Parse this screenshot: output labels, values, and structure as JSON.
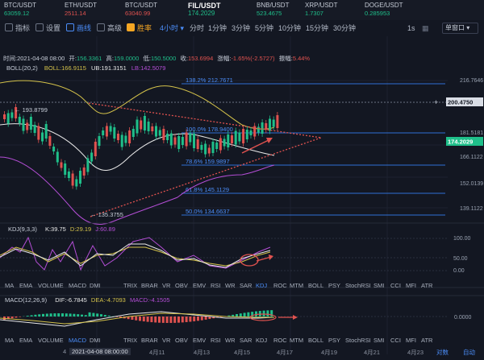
{
  "tickers": [
    {
      "sym": "BTC/USDT",
      "price": "63059.12",
      "dir": "up",
      "active": false
    },
    {
      "sym": "ETH/USDT",
      "price": "2511.14",
      "dir": "dn",
      "active": false
    },
    {
      "sym": "BTC/USDT",
      "price": "63040.99",
      "dir": "dn",
      "active": false
    },
    {
      "sym": "FIL/USDT",
      "price": "174.2029",
      "dir": "up",
      "active": true
    },
    {
      "sym": "BNB/USDT",
      "price": "523.4675",
      "dir": "up",
      "active": false
    },
    {
      "sym": "XRP/USDT",
      "price": "1.7307",
      "dir": "up",
      "active": false
    },
    {
      "sym": "DOGE/USDT",
      "price": "0.285953",
      "dir": "up",
      "active": false
    }
  ],
  "toolbar": {
    "indicators": "指标",
    "settings": "设置",
    "drawing": "画线",
    "advanced": "高级",
    "winrate": "胜率",
    "interval": "4小时",
    "intervals": [
      "分时",
      "1分钟",
      "3分钟",
      "5分钟",
      "10分钟",
      "15分钟",
      "30分钟"
    ],
    "seconds": "1s",
    "layout": "单窗口"
  },
  "info": {
    "time_label": "时间:",
    "time": "2021-04-08 08:00",
    "open_label": "开:",
    "open": "156.3361",
    "high_label": "高:",
    "high": "159.0000",
    "low_label": "低:",
    "low": "150.5000",
    "close_label": "收:",
    "close": "153.6994",
    "change_label": "涨幅:",
    "change": "-1.65%(-2.5727)",
    "amp_label": "振幅:",
    "amp": "5.44%"
  },
  "boll": {
    "name": "BOLL(20,2)",
    "mid": "BOLL:166.9115",
    "up": "UB:191.3151",
    "low": "LB:142.5079"
  },
  "price_axis": [
    "216.7646",
    "181.5181",
    "166.1122",
    "152.0139",
    "139.1122"
  ],
  "price_tags": {
    "crosshair": "200.4750",
    "last": "174.2029",
    "plus": "+"
  },
  "fib": [
    {
      "label": "138.2% 212.7671"
    },
    {
      "label": "100.0% 178.9400"
    },
    {
      "label": "78.6% 159.9897"
    },
    {
      "label": "61.8% 145.1129"
    },
    {
      "label": "50.0% 134.6637"
    }
  ],
  "annotations": {
    "high": "193.8799",
    "low": "135.3755"
  },
  "kdj": {
    "name": "KDJ(9,3,3)",
    "k": "K:39.75",
    "d": "D:29.19",
    "j": "J:60.89",
    "axis": [
      "100.00",
      "50.00",
      "0.00"
    ]
  },
  "tabs": [
    "MA",
    "EMA",
    "VOLUME",
    "MACD",
    "DMI",
    "TRIX",
    "BRAR",
    "VR",
    "OBV",
    "EMV",
    "RSI",
    "WR",
    "SAR",
    "KDJ",
    "ROC",
    "MTM",
    "BOLL",
    "PSY",
    "StochRSI",
    "SMI",
    "CCI",
    "MFI",
    "ATR"
  ],
  "macd": {
    "name": "MACD(12,26,9)",
    "dif": "DIF:-6.7845",
    "dea": "DEA:-4.7093",
    "macd": "MACD:-4.1505",
    "axis": [
      "0.0000"
    ]
  },
  "xaxis": {
    "cursor": "2021-04-08 08:00:00",
    "labels": [
      "4月11",
      "4月13",
      "4月15",
      "4月17",
      "4月19",
      "4月21",
      "4月23"
    ],
    "left": "4",
    "scale": "对数",
    "auto": "自动"
  }
}
